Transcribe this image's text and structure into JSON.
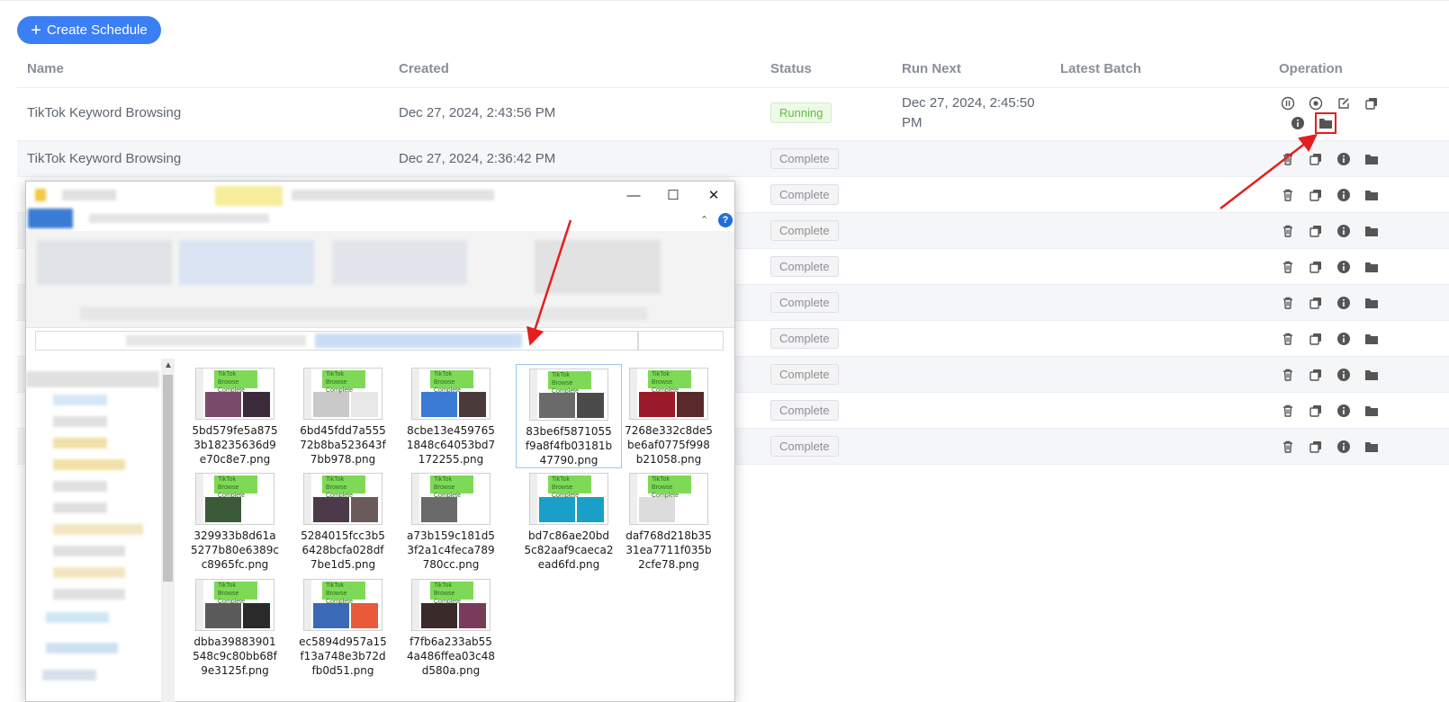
{
  "toolbar": {
    "create_label": "Create Schedule"
  },
  "columns": [
    "Name",
    "Created",
    "Status",
    "Run Next",
    "Latest Batch",
    "Operation"
  ],
  "rows": [
    {
      "name": "TikTok Keyword Browsing",
      "created": "Dec 27, 2024, 2:43:56 PM",
      "status": "Running",
      "run_next_1": "Dec 27, 2024, 2:45:50",
      "run_next_2": "PM"
    },
    {
      "name": "TikTok Keyword Browsing",
      "created": "Dec 27, 2024, 2:36:42 PM",
      "status": "Complete"
    },
    {
      "status": "Complete"
    },
    {
      "status": "Complete"
    },
    {
      "status": "Complete"
    },
    {
      "status": "Complete"
    },
    {
      "status": "Complete"
    },
    {
      "status": "Complete"
    },
    {
      "status": "Complete"
    },
    {
      "status": "Complete"
    }
  ],
  "explorer": {
    "help": "?",
    "thumb_badge_1": "TikTok Browse",
    "thumb_badge_2": "Complete",
    "files": [
      [
        "5bd579fe5a875",
        "3b18235636d9",
        "e70c8e7.png"
      ],
      [
        "6bd45fdd7a555",
        "72b8ba523643f",
        "7bb978.png"
      ],
      [
        "8cbe13e459765",
        "1848c64053bd7",
        "172255.png"
      ],
      [
        "83be6f5871055",
        "f9a8f4fb03181b",
        "47790.png"
      ],
      [
        "7268e332c8de5",
        "be6af0775f998",
        "b21058.png"
      ],
      [
        "329933b8d61a",
        "5277b80e6389c",
        "c8965fc.png"
      ],
      [
        "5284015fcc3b5",
        "6428bcfa028df",
        "7be1d5.png"
      ],
      [
        "a73b159c181d5",
        "3f2a1c4feca789",
        "780cc.png"
      ],
      [
        "bd7c86ae20bd",
        "5c82aaf9caeca2",
        "ead6fd.png"
      ],
      [
        "daf768d218b35",
        "31ea7711f035b",
        "2cfe78.png"
      ],
      [
        "dbba39883901",
        "548c9c80bb68f",
        "9e3125f.png"
      ],
      [
        "ec5894d957a15",
        "f13a748e3b72d",
        "fb0d51.png"
      ],
      [
        "f7fb6a233ab55",
        "4a486ffea03c48",
        "d580a.png"
      ]
    ],
    "selected_index": 3
  },
  "colors": {
    "primary": "#3b7ff5",
    "running": "#5fbf3a",
    "highlight": "#e41e1e"
  }
}
